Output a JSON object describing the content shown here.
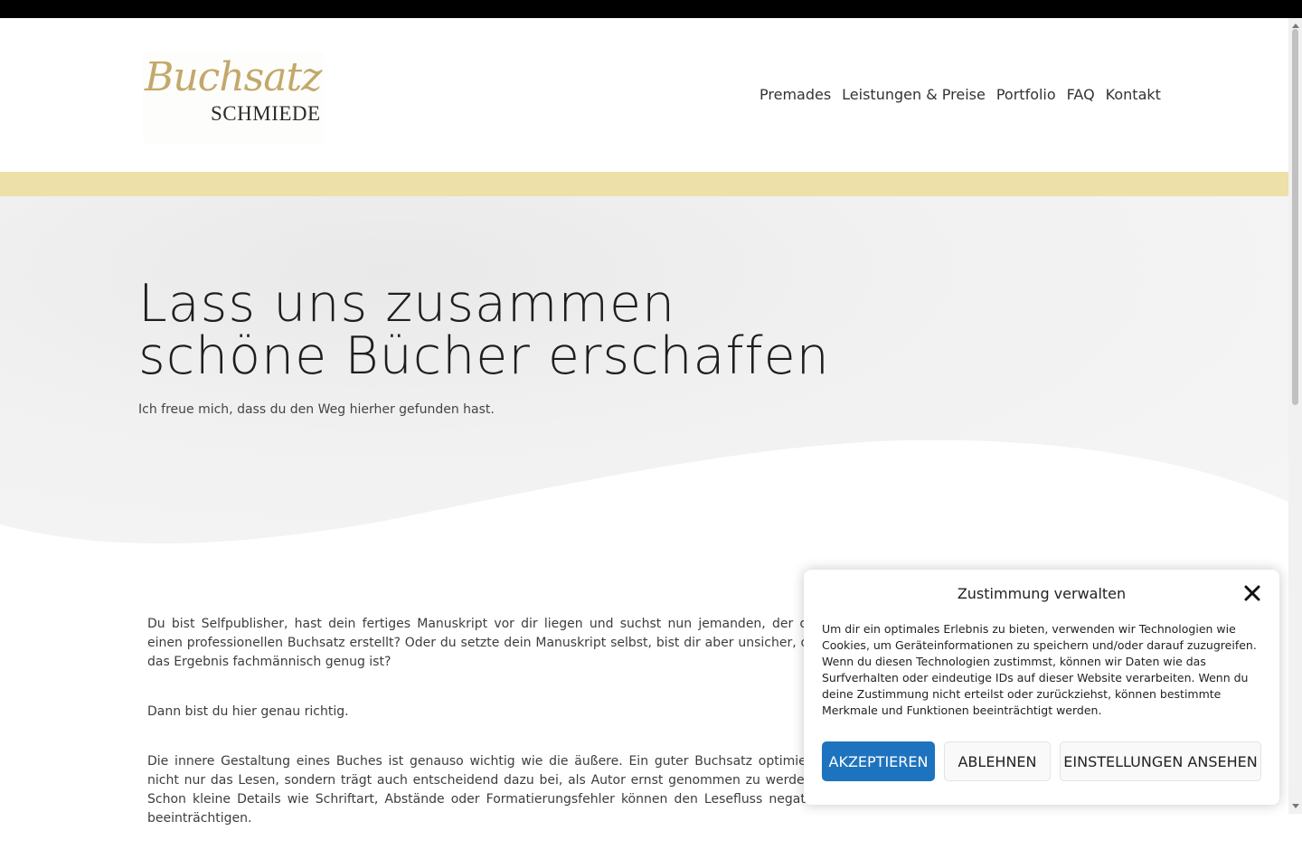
{
  "logo": {
    "script": "Buchsatz",
    "caps": "SCHMIEDE"
  },
  "nav": {
    "items": [
      {
        "label": "Premades"
      },
      {
        "label": "Leistungen & Preise"
      },
      {
        "label": "Portfolio"
      },
      {
        "label": "FAQ"
      },
      {
        "label": "Kontakt"
      }
    ]
  },
  "hero": {
    "title_line1": "Lass uns zusammen",
    "title_line2": "schöne Bücher erschaffen",
    "subtitle": "Ich freue mich, dass du den Weg hierher gefunden hast."
  },
  "content": {
    "paragraphs": [
      "Du bist Selfpublisher, hast dein fertiges Manuskript vor dir liegen und suchst nun jemanden, der dir einen professionellen Buchsatz erstellt? Oder du setzte dein Manuskript selbst, bist dir aber unsicher, ob das Ergebnis fachmännisch genug ist?",
      "Dann bist du hier genau richtig.",
      "Die innere Gestaltung eines Buches ist genauso wichtig wie die äußere. Ein guter Buchsatz optimiert nicht nur das Lesen, sondern trägt auch entscheidend dazu bei, als Autor ernst genommen zu werden. Schon kleine Details wie Schriftart, Abstände oder Formatierungsfehler können den Lesefluss negativ beeinträchtigen."
    ]
  },
  "cookie": {
    "title": "Zustimmung verwalten",
    "text": "Um dir ein optimales Erlebnis zu bieten, verwenden wir Technologien wie Cookies, um Geräteinformationen zu speichern und/oder darauf zuzugreifen. Wenn du diesen Technologien zustimmst, können wir Daten wie das Surfverhalten oder eindeutige IDs auf dieser Website verarbeiten. Wenn du deine Zustimmung nicht erteilst oder zurückziehst, können bestimmte Merkmale und Funktionen beeinträchtigt werden.",
    "accept_label": "AKZEPTIEREN",
    "deny_label": "ABLEHNEN",
    "settings_label": "EINSTELLUNGEN ANSEHEN"
  },
  "colors": {
    "gold_band": "#ede0a9",
    "logo_gold": "#c3a86b",
    "accept_blue": "#1e73be"
  }
}
